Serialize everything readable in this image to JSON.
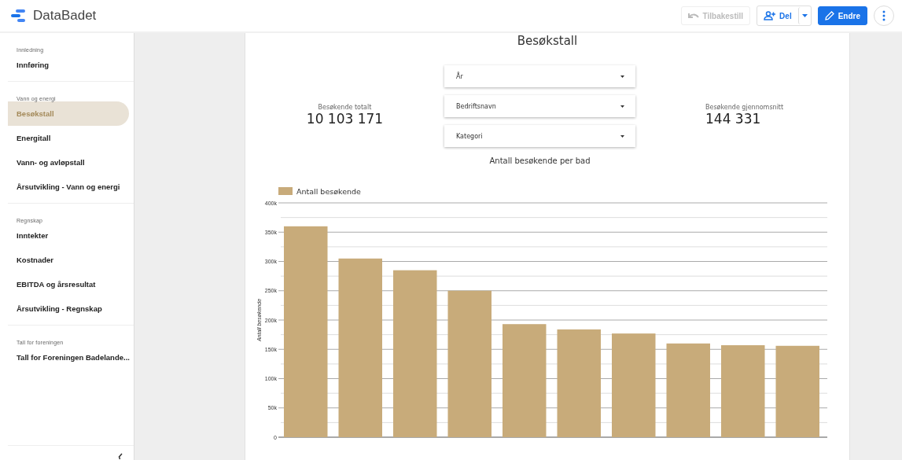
{
  "app": {
    "title": "DataBadet"
  },
  "toolbar": [
    {
      "kind": "reset",
      "label": "Tilbakestill",
      "disabled": true
    },
    {
      "kind": "share",
      "label": "Del",
      "disabled": false
    },
    {
      "kind": "edit",
      "label": "Endre",
      "disabled": false
    },
    {
      "kind": "more",
      "disabled": false
    }
  ],
  "sidebar": {
    "sections": [
      {
        "heading": "Innledning",
        "items": [
          {
            "label": "Innføring",
            "selected": false
          }
        ]
      },
      {
        "heading": "Vann og energi",
        "items": [
          {
            "label": "Besøkstall",
            "selected": true
          },
          {
            "label": "Energitall",
            "selected": false
          },
          {
            "label": "Vann- og avløpstall",
            "selected": false
          },
          {
            "label": "Årsutvikling - Vann og energi",
            "selected": false
          }
        ]
      },
      {
        "heading": "Regnskap",
        "items": [
          {
            "label": "Inntekter",
            "selected": false
          },
          {
            "label": "Kostnader",
            "selected": false
          },
          {
            "label": "EBITDA og årsresultat",
            "selected": false
          },
          {
            "label": "Årsutvikling - Regnskap",
            "selected": false
          }
        ]
      },
      {
        "heading": "Tall for foreningen",
        "items": [
          {
            "label": "Tall for Foreningen Badelande...",
            "selected": false
          }
        ]
      }
    ]
  },
  "report": {
    "title": "Besøkstall",
    "kpis": [
      {
        "label": "Besøkende totalt",
        "value": "10 103 171"
      },
      {
        "label": "Besøkende gjennomsnitt",
        "value": "144 331"
      }
    ],
    "filters": [
      {
        "label": "År"
      },
      {
        "label": "Bedriftsnavn"
      },
      {
        "label": "Kategori"
      }
    ],
    "chart_title": "Antall besøkende per bad",
    "chart_data": {
      "type": "bar",
      "grid": true,
      "ylabel": "Antall besøkende",
      "ylim": [
        0,
        400000
      ],
      "yticks": [
        {
          "value": 0,
          "label": "0"
        },
        {
          "value": 50000,
          "label": "50k"
        },
        {
          "value": 100000,
          "label": "100k"
        },
        {
          "value": 150000,
          "label": "150k"
        },
        {
          "value": 200000,
          "label": "200k"
        },
        {
          "value": 250000,
          "label": "250k"
        },
        {
          "value": 300000,
          "label": "300k"
        },
        {
          "value": 350000,
          "label": "350k"
        },
        {
          "value": 400000,
          "label": "400k"
        }
      ],
      "series": [
        {
          "name": "Antall besøkende",
          "color": "#c8ab7a",
          "values": [
            360000,
            305000,
            285000,
            250000,
            193000,
            184000,
            177000,
            160000,
            157000,
            156000
          ]
        }
      ]
    }
  }
}
